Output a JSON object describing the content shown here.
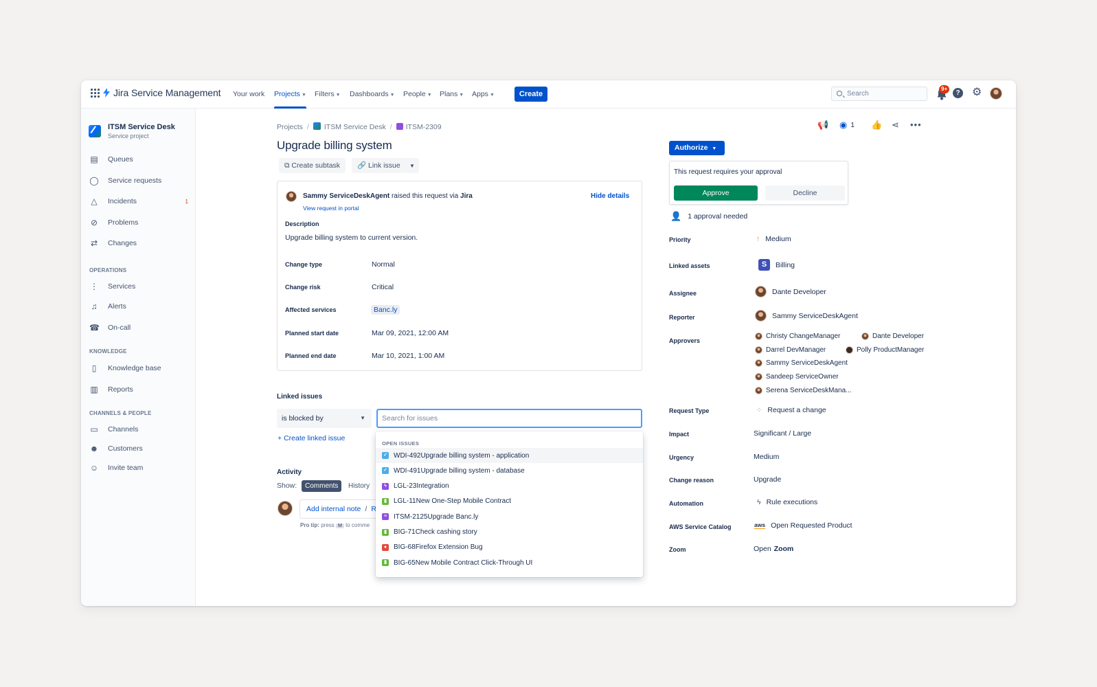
{
  "topnav": {
    "product": "Jira Service Management",
    "items": [
      {
        "label": "Your work",
        "has_menu": false
      },
      {
        "label": "Projects",
        "has_menu": true
      },
      {
        "label": "Filters",
        "has_menu": true
      },
      {
        "label": "Dashboards",
        "has_menu": true
      },
      {
        "label": "People",
        "has_menu": true
      },
      {
        "label": "Plans",
        "has_menu": true
      },
      {
        "label": "Apps",
        "has_menu": true
      }
    ],
    "active_item": "Projects",
    "create_label": "Create",
    "search_placeholder": "Search",
    "notification_badge": "9+"
  },
  "sidebar": {
    "project_name": "ITSM Service Desk",
    "project_type": "Service project",
    "main_items": [
      {
        "label": "Queues",
        "icon": "queues-icon"
      },
      {
        "label": "Service requests",
        "icon": "chat-icon"
      },
      {
        "label": "Incidents",
        "icon": "warning-icon",
        "count": "1"
      },
      {
        "label": "Problems",
        "icon": "problem-icon"
      },
      {
        "label": "Changes",
        "icon": "changes-icon"
      }
    ],
    "sections": [
      {
        "heading": "OPERATIONS",
        "items": [
          {
            "label": "Services"
          },
          {
            "label": "Alerts"
          },
          {
            "label": "On-call"
          }
        ]
      },
      {
        "heading": "KNOWLEDGE",
        "items": [
          {
            "label": "Knowledge base"
          },
          {
            "label": "Reports"
          }
        ]
      },
      {
        "heading": "CHANNELS & PEOPLE",
        "items": [
          {
            "label": "Channels"
          },
          {
            "label": "Customers"
          },
          {
            "label": "Invite team"
          }
        ]
      }
    ]
  },
  "breadcrumb": [
    "Projects",
    "ITSM Service Desk",
    "ITSM-2309"
  ],
  "issue": {
    "title": "Upgrade billing system",
    "actions": {
      "create_subtask": "Create subtask",
      "link_issue": "Link issue"
    },
    "watchers": "1",
    "reporter_line": {
      "name": "Sammy ServiceDeskAgent",
      "text": "raised this request via",
      "channel": "Jira"
    },
    "view_portal": "View request in portal",
    "hide_details": "Hide details",
    "description_label": "Description",
    "description": "Upgrade billing system to current version.",
    "fields": [
      {
        "label": "Change type",
        "value": "Normal"
      },
      {
        "label": "Change risk",
        "value": "Critical"
      },
      {
        "label": "Affected services",
        "value": "Banc.ly"
      },
      {
        "label": "Planned start date",
        "value": "Mar 09, 2021, 12:00 AM"
      },
      {
        "label": "Planned end date",
        "value": "Mar 10, 2021, 1:00 AM"
      }
    ]
  },
  "linked_issues": {
    "heading": "Linked issues",
    "relation": "is blocked by",
    "search_placeholder": "Search for issues",
    "create_label": "Create linked issue",
    "dropdown_heading": "OPEN ISSUES",
    "results": [
      {
        "key": "WDI-492",
        "summary": "Upgrade billing system - application",
        "type": "task",
        "color": "#4bade8"
      },
      {
        "key": "WDI-491",
        "summary": "Upgrade billing system - database",
        "type": "task",
        "color": "#4bade8"
      },
      {
        "key": "LGL-23",
        "summary": "Integration",
        "type": "epic",
        "color": "#904ee2"
      },
      {
        "key": "LGL-11",
        "summary": "New One-Step Mobile Contract",
        "type": "story",
        "color": "#63ba3c"
      },
      {
        "key": "ITSM-2125",
        "summary": "Upgrade Banc.ly",
        "type": "change",
        "color": "#904ee2"
      },
      {
        "key": "BIG-71",
        "summary": "Check cashing story",
        "type": "story",
        "color": "#63ba3c"
      },
      {
        "key": "BIG-68",
        "summary": "Firefox Extension Bug",
        "type": "bug",
        "color": "#e5493a"
      },
      {
        "key": "BIG-65",
        "summary": "New Mobile Contract Click-Through UI",
        "type": "story",
        "color": "#63ba3c"
      }
    ]
  },
  "activity": {
    "heading": "Activity",
    "show_label": "Show:",
    "tabs": [
      "Comments",
      "History"
    ],
    "active_tab": "Comments",
    "add_note": "Add internal note",
    "divider": "/",
    "reply_initial": "R",
    "protip_prefix": "Pro tip:",
    "protip_press": "press",
    "protip_key": "M",
    "protip_suffix": "to comme"
  },
  "approval": {
    "authorize_label": "Authorize",
    "message": "This request requires your approval",
    "approve_label": "Approve",
    "decline_label": "Decline",
    "needed": "1 approval needed"
  },
  "details": {
    "priority": {
      "label": "Priority",
      "value": "Medium"
    },
    "linked_assets": {
      "label": "Linked assets",
      "value": "Billing"
    },
    "assignee": {
      "label": "Assignee",
      "value": "Dante Developer"
    },
    "reporter": {
      "label": "Reporter",
      "value": "Sammy ServiceDeskAgent"
    },
    "approvers": {
      "label": "Approvers",
      "values": [
        "Christy ChangeManager",
        "Dante Developer",
        "Darrel DevManager",
        "Polly ProductManager",
        "Sammy ServiceDeskAgent",
        "Sandeep ServiceOwner",
        "Serena ServiceDeskMana..."
      ]
    },
    "request_type": {
      "label": "Request Type",
      "value": "Request a change"
    },
    "impact": {
      "label": "Impact",
      "value": "Significant / Large"
    },
    "urgency": {
      "label": "Urgency",
      "value": "Medium"
    },
    "change_reason": {
      "label": "Change reason",
      "value": "Upgrade"
    },
    "automation": {
      "label": "Automation",
      "value": "Rule executions"
    },
    "aws": {
      "label": "AWS Service Catalog",
      "value": "Open Requested Product",
      "logo_text": "aws"
    },
    "zoom": {
      "label": "Zoom",
      "value_prefix": "Open",
      "value_strong": "Zoom"
    }
  },
  "colors": {
    "brand": "#0052cc",
    "approve": "#00875a",
    "danger": "#de350b"
  }
}
